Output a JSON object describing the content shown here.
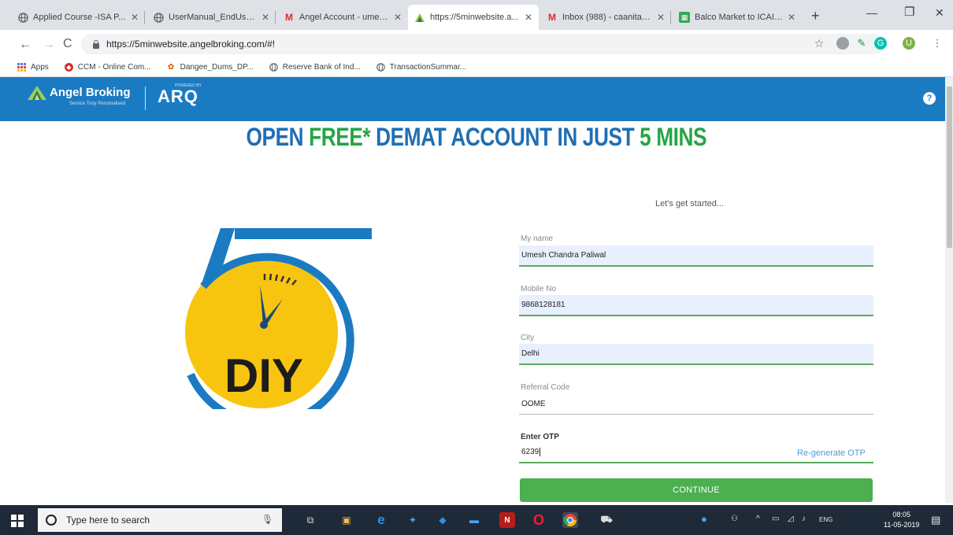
{
  "browser": {
    "tabs": [
      {
        "title": "Applied Course -ISA P...",
        "icon": "globe-icon",
        "active": false
      },
      {
        "title": "UserManual_EndUser...",
        "icon": "globe-icon",
        "active": false
      },
      {
        "title": "Angel Account - umes...",
        "icon": "gmail-icon",
        "active": false
      },
      {
        "title": "https://5minwebsite.a...",
        "icon": "angel-icon",
        "active": true
      },
      {
        "title": "Inbox (988) - caanita.7...",
        "icon": "gmail-icon",
        "active": false
      },
      {
        "title": "Balco Market to ICAI I...",
        "icon": "sheet-icon",
        "active": false
      }
    ],
    "new_tab": "+",
    "url": "https://5minwebsite.angelbroking.com/#!",
    "bookmarks": [
      {
        "label": "Apps",
        "icon": "apps-icon"
      },
      {
        "label": "CCM - Online Com...",
        "icon": "ccm-icon"
      },
      {
        "label": "Dangee_Dums_DP...",
        "icon": "dangee-icon"
      },
      {
        "label": "Reserve Bank of Ind...",
        "icon": "globe-icon"
      },
      {
        "label": "TransactionSummar...",
        "icon": "globe-icon"
      }
    ]
  },
  "header": {
    "brand": "Angel Broking",
    "tagline": "Service Truly Personalised",
    "product": "ARQ",
    "product_small": "POWERED BY",
    "help": "?"
  },
  "main": {
    "headline": {
      "part1": "OPEN ",
      "part2": "FREE*",
      "part3": " DEMAT ACCOUNT IN JUST ",
      "part4": "5 MINS"
    },
    "illustration_text": "DIY",
    "intro": "Let's get started...",
    "form": {
      "name_label": "My name",
      "name_value": "Umesh Chandra Paliwal",
      "mobile_label": "Mobile No",
      "mobile_value": "9868128181",
      "city_label": "City",
      "city_value": "Delhi",
      "referral_label": "Referral Code",
      "referral_value": "OOME",
      "otp_label": "Enter OTP",
      "otp_value": "6239",
      "regenerate": "Re-generate OTP",
      "continue": "CONTINUE"
    }
  },
  "taskbar": {
    "search_placeholder": "Type here to search",
    "language": "ENG",
    "time": "08:05",
    "date": "11-05-2019"
  },
  "colors": {
    "header_blue": "#1b7bc2",
    "headline_blue": "#1f6fb3",
    "headline_green": "#27a546",
    "button_green": "#4caf50",
    "dial_yellow": "#f7c510"
  }
}
